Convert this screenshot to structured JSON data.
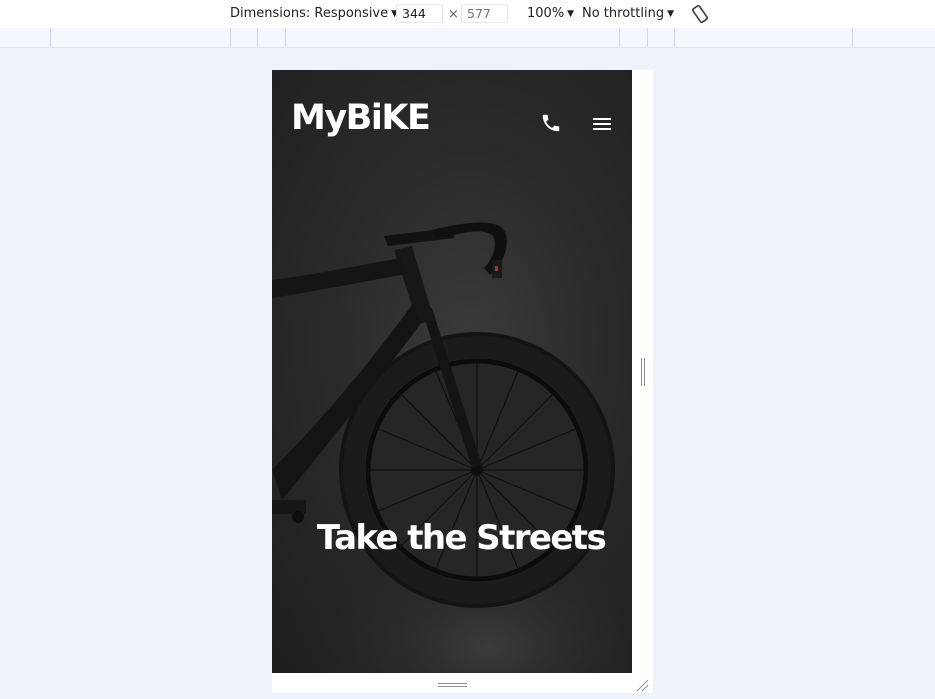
{
  "devtools": {
    "dimensions_label": "Dimensions: Responsive",
    "width_value": "344",
    "height_placeholder": "577",
    "times_symbol": "×",
    "zoom_label": "100%",
    "throttle_label": "No throttling",
    "caret": "▼",
    "rotate_icon": "rotate-device-icon"
  },
  "site": {
    "logo": "MyBiKE",
    "phone_icon": "phone-icon",
    "menu_icon": "hamburger-menu-icon",
    "hero_title": "Take the Streets",
    "colors": {
      "background": "#2b2b2b",
      "text": "#ffffff"
    }
  }
}
